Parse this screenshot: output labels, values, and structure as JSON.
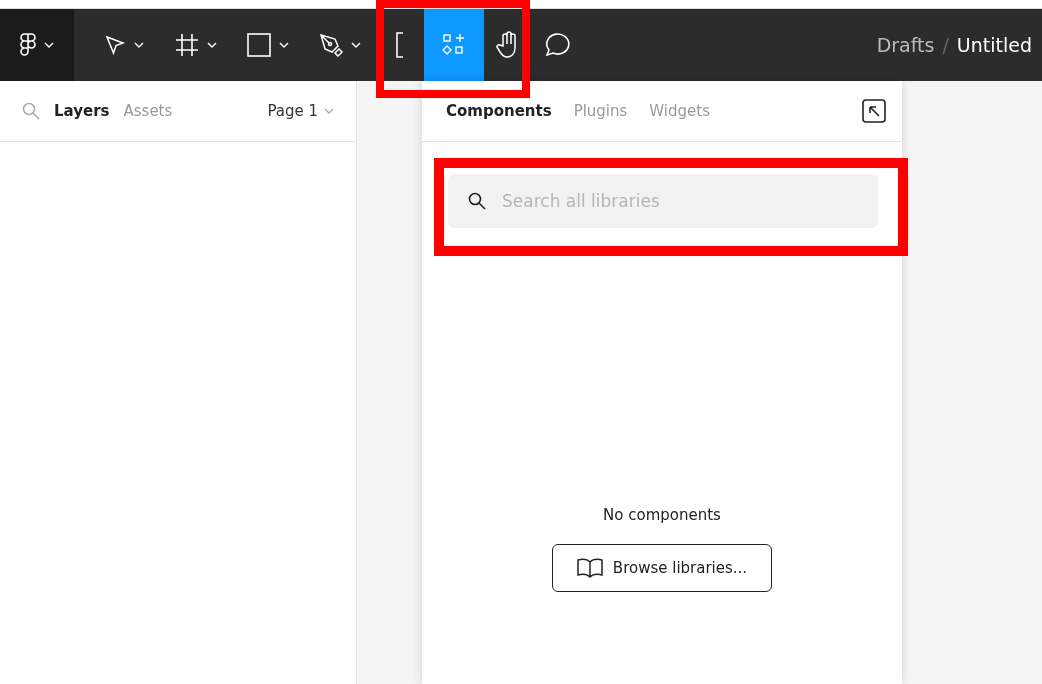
{
  "toolbar": {
    "tools": [
      {
        "kind": "move",
        "caret": true,
        "selected": false
      },
      {
        "kind": "frame",
        "caret": true,
        "selected": false
      },
      {
        "kind": "shape",
        "caret": true,
        "selected": false
      },
      {
        "kind": "pen",
        "caret": true,
        "selected": false
      },
      {
        "kind": "text",
        "caret": false,
        "selected": false
      },
      {
        "kind": "resources",
        "caret": false,
        "selected": true
      },
      {
        "kind": "hand",
        "caret": false,
        "selected": false
      },
      {
        "kind": "comment",
        "caret": false,
        "selected": false
      }
    ],
    "breadcrumb": {
      "folder": "Drafts",
      "separator": "/",
      "file": "Untitled"
    }
  },
  "left_panel": {
    "tabs": [
      {
        "label": "Layers",
        "selected": true
      },
      {
        "label": "Assets",
        "selected": false
      }
    ],
    "page": "Page 1"
  },
  "resources_panel": {
    "tabs": [
      {
        "label": "Components",
        "selected": true
      },
      {
        "label": "Plugins",
        "selected": false
      },
      {
        "label": "Widgets",
        "selected": false
      }
    ],
    "search": {
      "placeholder": "Search all libraries"
    },
    "empty_message": "No components",
    "browse_button": "Browse libraries..."
  }
}
